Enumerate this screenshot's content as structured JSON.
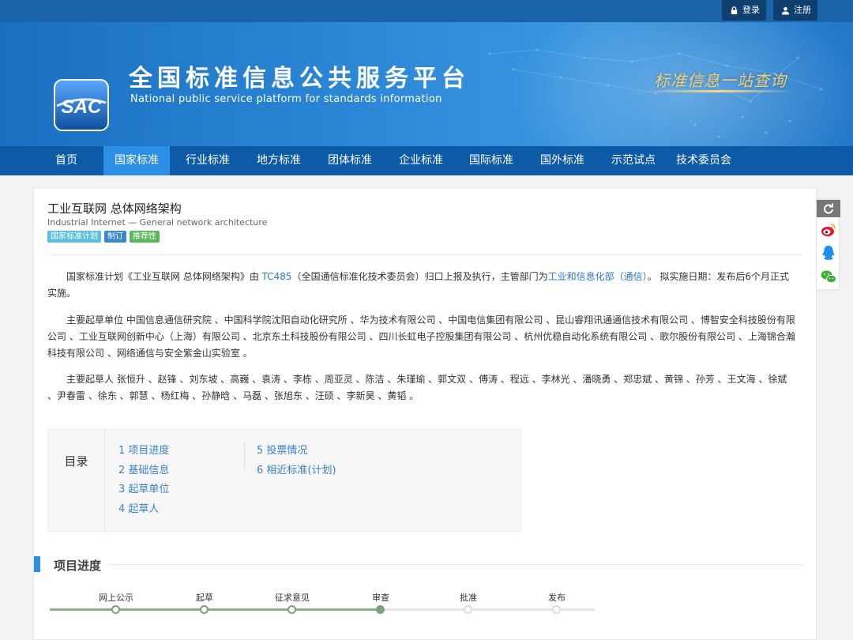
{
  "topbar": {
    "login": "登录",
    "register": "注册"
  },
  "site": {
    "logo_text": "SAC",
    "title": "全国标准信息公共服务平台",
    "subtitle": "National public service platform  for standards information",
    "slogan": "标准信息一站查询"
  },
  "nav": [
    "首页",
    "国家标准",
    "行业标准",
    "地方标准",
    "团体标准",
    "企业标准",
    "国际标准",
    "国外标准",
    "示范试点",
    "技术委员会"
  ],
  "nav_active": 1,
  "plan": {
    "title": "工业互联网 总体网络架构",
    "subtitle": "Industrial Internet — General network architecture",
    "tags": [
      {
        "label": "国家标准计划",
        "color": "#5bc0de"
      },
      {
        "label": "制订",
        "color": "#3a87c9"
      },
      {
        "label": "推荐性",
        "color": "#5cb85c"
      }
    ],
    "intro_a": "国家标准计划《工业互联网 总体网络架构》由 ",
    "intro_tc": "TC485",
    "intro_b": "（全国通信标准化技术委员会）归口上报及执行，主管部门为",
    "intro_dept": "工业和信息化部（通信）",
    "intro_c": "。 拟实施日期：发布后6个月正式实施。",
    "units": "主要起草单位 中国信息通信研究院 、中国科学院沈阳自动化研究所 、华为技术有限公司 、中国电信集团有限公司 、昆山睿翔讯通通信技术有限公司 、博智安全科技股份有限公司 、工业互联网创新中心（上海）有限公司 、北京东土科技股份有限公司 、四川长虹电子控股集团有限公司 、杭州优稳自动化系统有限公司 、歌尔股份有限公司 、上海锦合瀚科技有限公司 、网络通信与安全紫金山实验室 。",
    "people": "主要起草人 张恒升 、赵锋 、刘东坡 、高巍 、袁涛 、李栋 、周亚灵 、陈洁 、朱瑾瑜 、郭文双 、傅涛 、程远 、李林光 、潘晓勇 、郑忠斌 、黄锦 、孙芳 、王文海 、徐斌 、尹春雷 、徐东 、郭慧 、杨红梅 、孙静晗 、马磊 、张旭东 、汪硕 、李新昊 、黄韬 。"
  },
  "toc": {
    "label": "目录",
    "col1": [
      "1 项目进度",
      "2 基础信息",
      "3 起草单位",
      "4 起草人"
    ],
    "col2": [
      "5 投票情况",
      "6 相近标准(计划)"
    ]
  },
  "section_progress": {
    "title": "项目进度",
    "steps": [
      "网上公示",
      "起草",
      "征求意见",
      "审查",
      "批准",
      "发布"
    ],
    "current_step": 4
  }
}
